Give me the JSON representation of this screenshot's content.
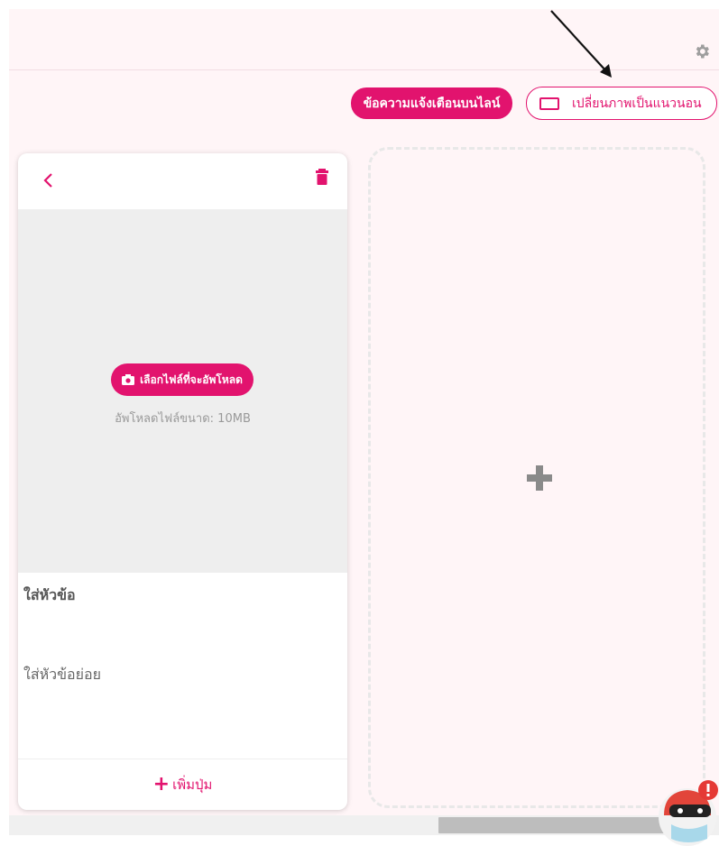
{
  "toolbar": {
    "settings_icon": "gear-icon",
    "notify_label": "ข้อความแจ้งเตือนบนไลน์",
    "rotate_label": "เปลี่ยนภาพเป็นแนวนอน",
    "accent": "#e2136e"
  },
  "card": {
    "back_icon": "chevron-left-icon",
    "delete_icon": "trash-icon",
    "upload_button_label": "เลือกไฟล์ที่จะอัพโหลด",
    "upload_hint": "อัพโหลดไฟล์ขนาด: 10MB",
    "title_placeholder": "ใส่หัวข้อ",
    "subtitle_placeholder": "ใส่หัวข้อย่อย",
    "add_button_label": "เพิ่มปุ่ม"
  },
  "empty_slot": {
    "add_icon": "plus-icon"
  },
  "colors": {
    "background": "#fff5f7",
    "accent": "#e2136e",
    "image_placeholder": "#eeeeee"
  }
}
